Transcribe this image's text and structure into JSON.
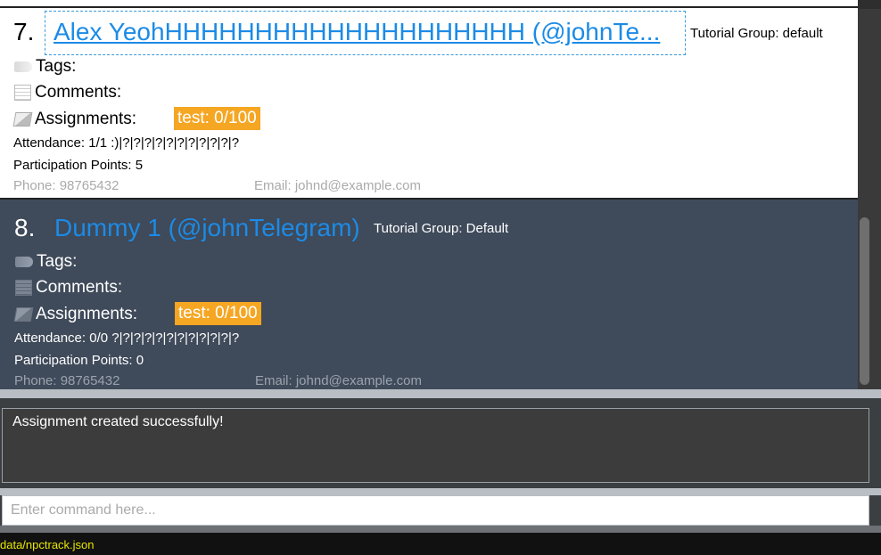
{
  "persons": [
    {
      "index": "7.",
      "name": "Alex YeohHHHHHHHHHHHHHHHHHHHH (@johnTe...",
      "tutorial_group": "Tutorial Group: default",
      "tags_label": "Tags:",
      "comments_label": "Comments:",
      "assignments_label": "Assignments:",
      "assignment_badge": "test: 0/100",
      "attendance": "Attendance: 1/1  :)|?|?|?|?|?|?|?|?|?|?|?",
      "participation": "Participation Points: 5",
      "phone": "Phone: 98765432",
      "email": "Email: johnd@example.com"
    },
    {
      "index": "8.",
      "name": "Dummy 1 (@johnTelegram)",
      "tutorial_group": "Tutorial Group: Default",
      "tags_label": "Tags:",
      "comments_label": "Comments:",
      "assignments_label": "Assignments:",
      "assignment_badge": "test: 0/100",
      "attendance": "Attendance: 0/0  ?|?|?|?|?|?|?|?|?|?|?|?",
      "participation": "Participation Points: 0",
      "phone": "Phone: 98765432",
      "email": "Email: johnd@example.com"
    }
  ],
  "result": {
    "message": "Assignment created successfully!"
  },
  "command": {
    "placeholder": "Enter command here..."
  },
  "status": {
    "file_path": "data/npctrack.json"
  },
  "colors": {
    "name_link": "#1c8be6",
    "badge": "#f5a623",
    "selected_card": "#3f4a5a",
    "status_text": "#e6e600"
  }
}
